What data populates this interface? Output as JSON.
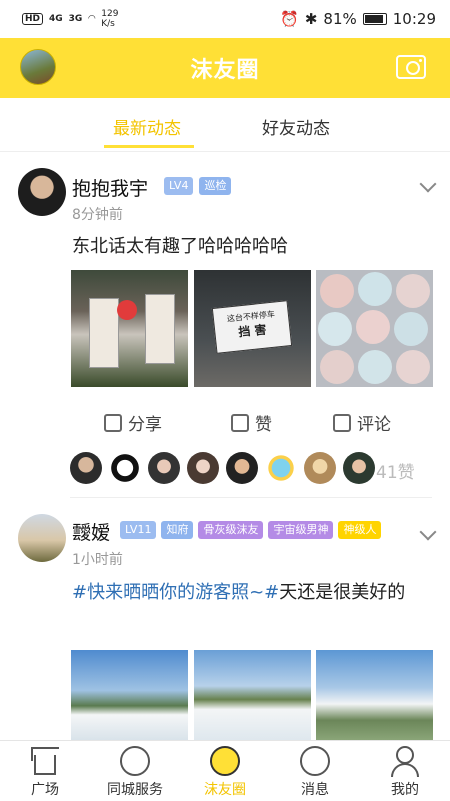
{
  "status_bar": {
    "hd": "HD",
    "net_top": "4G",
    "net_bottom": "3G",
    "speed_value": "129",
    "speed_unit": "K/s",
    "battery": "81%",
    "time": "10:29"
  },
  "header": {
    "title": "沫友圈"
  },
  "tabs": [
    {
      "label": "最新动态",
      "active": true
    },
    {
      "label": "好友动态",
      "active": false
    }
  ],
  "posts": [
    {
      "author": "抱抱我宇",
      "badges": [
        {
          "text": "LV4",
          "color": "#9cbcf0"
        },
        {
          "text": "巡检",
          "color": "#8fb4ee"
        }
      ],
      "time": "8分钟前",
      "text": "东北话太有趣了哈哈哈哈哈",
      "images": [
        "street-scene",
        "sign-photo",
        "eggs-photo"
      ],
      "image_texts": {
        "sign_line1": "这台不样停车",
        "sign_line2": "挡 害"
      },
      "actions": {
        "share": "分享",
        "like": "赞",
        "comment": "评论"
      },
      "likers": 8,
      "like_count": "41赞"
    },
    {
      "author": "靉嫒",
      "badges": [
        {
          "text": "LV11",
          "color": "#9cbcf0"
        },
        {
          "text": "知府",
          "color": "#8fb4ee"
        },
        {
          "text": "骨灰级沫友",
          "color": "#b48be6"
        },
        {
          "text": "宇宙级男神",
          "color": "#b48be6"
        },
        {
          "text": "神级人",
          "color": "#ffd400"
        }
      ],
      "time": "1小时前",
      "hashtag": "#快来晒晒你的游客照~#",
      "text_rest": "天还是很美好的",
      "images": [
        "cloud-sea-1",
        "cloud-sea-2",
        "cloud-sea-3"
      ]
    }
  ],
  "bottom_nav": [
    {
      "label": "广场",
      "icon": "home-icon"
    },
    {
      "label": "同城服务",
      "icon": "grid-icon"
    },
    {
      "label": "沫友圈",
      "icon": "eye-icon",
      "active": true
    },
    {
      "label": "消息",
      "icon": "message-icon"
    },
    {
      "label": "我的",
      "icon": "user-icon"
    }
  ],
  "colors": {
    "brand": "#ffe036",
    "active_tab": "#f3c400",
    "hashtag": "#2f6fb4"
  }
}
